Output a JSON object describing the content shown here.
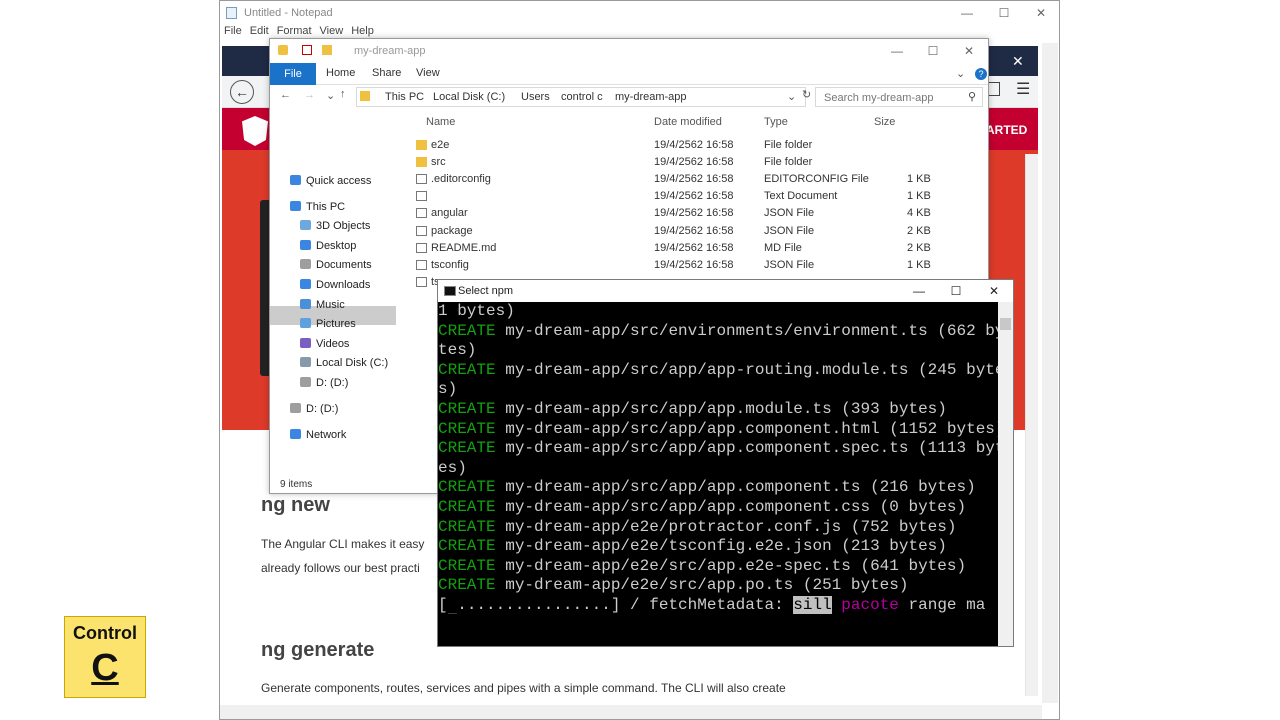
{
  "notepad": {
    "title": "Untitled - Notepad",
    "menu": [
      "File",
      "Edit",
      "Format",
      "View",
      "Help"
    ]
  },
  "browser": {
    "cta_text": "ARTED",
    "sections": [
      {
        "heading": "ng new",
        "lines": [
          "The Angular CLI makes it easy",
          "already follows our best practi"
        ]
      },
      {
        "heading": "ng generate",
        "lines": [
          "Generate components, routes, services and pipes with a simple command. The CLI will also create"
        ]
      }
    ]
  },
  "explorer": {
    "title": "my-dream-app",
    "ribbon": {
      "file": "File",
      "tabs": [
        "Home",
        "Share",
        "View"
      ]
    },
    "breadcrumb": [
      "This PC",
      "Local Disk (C:)",
      "Users",
      "control c",
      "my-dream-app"
    ],
    "search_placeholder": "Search my-dream-app",
    "nav": [
      {
        "label": "Quick access",
        "icon": "star-icon",
        "color": "#3a86e0"
      },
      {
        "label": "This PC",
        "icon": "computer-icon",
        "color": "#3a86e0"
      },
      {
        "label": "3D Objects",
        "icon": "cube-icon",
        "color": "#6fa8dc"
      },
      {
        "label": "Desktop",
        "icon": "desktop-icon",
        "color": "#3a86e0"
      },
      {
        "label": "Documents",
        "icon": "documents-icon",
        "color": "#9e9e9e"
      },
      {
        "label": "Downloads",
        "icon": "downloads-icon",
        "color": "#3a86e0"
      },
      {
        "label": "Music",
        "icon": "music-icon",
        "color": "#4a90d9"
      },
      {
        "label": "Pictures",
        "icon": "pictures-icon",
        "color": "#5fa0e0"
      },
      {
        "label": "Videos",
        "icon": "videos-icon",
        "color": "#7a5fc0"
      },
      {
        "label": "Local Disk (C:)",
        "icon": "disk-icon",
        "color": "#8899aa"
      },
      {
        "label": "D: (D:)",
        "icon": "drive-icon",
        "color": "#9e9e9e"
      },
      {
        "label": "D: (D:)",
        "icon": "drive-icon",
        "color": "#9e9e9e"
      },
      {
        "label": "Network",
        "icon": "network-icon",
        "color": "#3a86e0"
      }
    ],
    "columns": [
      "Name",
      "Date modified",
      "Type",
      "Size"
    ],
    "files": [
      {
        "name": "e2e",
        "date": "19/4/2562 16:58",
        "type": "File folder",
        "size": "",
        "icon": "folder-icon"
      },
      {
        "name": "src",
        "date": "19/4/2562 16:58",
        "type": "File folder",
        "size": "",
        "icon": "folder-icon"
      },
      {
        "name": ".editorconfig",
        "date": "19/4/2562 16:58",
        "type": "EDITORCONFIG File",
        "size": "1 KB",
        "icon": "file-icon"
      },
      {
        "name": "",
        "date": "19/4/2562 16:58",
        "type": "Text Document",
        "size": "1 KB",
        "icon": "text-file-icon"
      },
      {
        "name": "angular",
        "date": "19/4/2562 16:58",
        "type": "JSON File",
        "size": "4 KB",
        "icon": "json-file-icon"
      },
      {
        "name": "package",
        "date": "19/4/2562 16:58",
        "type": "JSON File",
        "size": "2 KB",
        "icon": "json-file-icon"
      },
      {
        "name": "README.md",
        "date": "19/4/2562 16:58",
        "type": "MD File",
        "size": "2 KB",
        "icon": "file-icon"
      },
      {
        "name": "tsconfig",
        "date": "19/4/2562 16:58",
        "type": "JSON File",
        "size": "1 KB",
        "icon": "json-file-icon"
      },
      {
        "name": "ts",
        "date": "",
        "type": "",
        "size": "",
        "icon": "json-file-icon"
      }
    ],
    "status": "9 items"
  },
  "terminal": {
    "title": "Select npm",
    "lines": [
      {
        "segments": [
          {
            "t": "1 bytes)",
            "c": ""
          }
        ]
      },
      {
        "segments": [
          {
            "t": "CREATE",
            "c": "g"
          },
          {
            "t": " my-dream-app/src/environments/environment.ts (662 by",
            "c": ""
          }
        ]
      },
      {
        "segments": [
          {
            "t": "tes)",
            "c": ""
          }
        ]
      },
      {
        "segments": [
          {
            "t": "CREATE",
            "c": "g"
          },
          {
            "t": " my-dream-app/src/app/app-routing.module.ts (245 byte",
            "c": ""
          }
        ]
      },
      {
        "segments": [
          {
            "t": "s)",
            "c": ""
          }
        ]
      },
      {
        "segments": [
          {
            "t": "CREATE",
            "c": "g"
          },
          {
            "t": " my-dream-app/src/app/app.module.ts (393 bytes)",
            "c": ""
          }
        ]
      },
      {
        "segments": [
          {
            "t": "CREATE",
            "c": "g"
          },
          {
            "t": " my-dream-app/src/app/app.component.html (1152 bytes)",
            "c": ""
          }
        ]
      },
      {
        "segments": [
          {
            "t": "CREATE",
            "c": "g"
          },
          {
            "t": " my-dream-app/src/app/app.component.spec.ts (1113 byt",
            "c": ""
          }
        ]
      },
      {
        "segments": [
          {
            "t": "es)",
            "c": ""
          }
        ]
      },
      {
        "segments": [
          {
            "t": "CREATE",
            "c": "g"
          },
          {
            "t": " my-dream-app/src/app/app.component.ts (216 bytes)",
            "c": ""
          }
        ]
      },
      {
        "segments": [
          {
            "t": "CREATE",
            "c": "g"
          },
          {
            "t": " my-dream-app/src/app/app.component.css (0 bytes)",
            "c": ""
          }
        ]
      },
      {
        "segments": [
          {
            "t": "CREATE",
            "c": "g"
          },
          {
            "t": " my-dream-app/e2e/protractor.conf.js (752 bytes)",
            "c": ""
          }
        ]
      },
      {
        "segments": [
          {
            "t": "CREATE",
            "c": "g"
          },
          {
            "t": " my-dream-app/e2e/tsconfig.e2e.json (213 bytes)",
            "c": ""
          }
        ]
      },
      {
        "segments": [
          {
            "t": "CREATE",
            "c": "g"
          },
          {
            "t": " my-dream-app/e2e/src/app.e2e-spec.ts (641 bytes)",
            "c": ""
          }
        ]
      },
      {
        "segments": [
          {
            "t": "CREATE",
            "c": "g"
          },
          {
            "t": " my-dream-app/e2e/src/app.po.ts (251 bytes)",
            "c": ""
          }
        ]
      },
      {
        "segments": [
          {
            "t": "[",
            "c": ""
          },
          {
            "t": "█",
            "c": "hl"
          },
          {
            "t": "................] / fetchMetadata: ",
            "c": ""
          },
          {
            "t": "sill",
            "c": "hl"
          },
          {
            "t": " ",
            "c": ""
          },
          {
            "t": "pacote",
            "c": "m"
          },
          {
            "t": " range ma",
            "c": ""
          }
        ]
      }
    ]
  },
  "badge": {
    "line1": "Control",
    "line2": "C"
  }
}
